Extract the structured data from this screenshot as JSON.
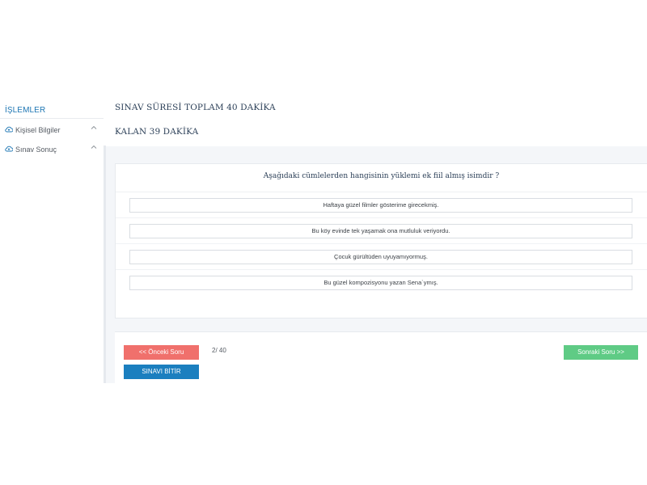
{
  "sidebar": {
    "heading": "İŞLEMLER",
    "items": [
      {
        "label": "Kişisel Bilgiler",
        "icon": "cloud-icon"
      },
      {
        "label": "Sınav Sonuç",
        "icon": "cloud-icon"
      }
    ]
  },
  "exam": {
    "total_time_label": "SINAV SÜRESİ TOPLAM 40 DAKİKA",
    "remaining_label": "KALAN 39 DAKİKA"
  },
  "question": {
    "text": "Aşağıdaki cümlelerden hangisinin yüklemi ek fiil almış isimdir ?",
    "options": [
      "Haftaya güzel filmler gösterime girecekmiş.",
      "Bu köy evinde tek yaşamak ona mutluluk veriyordu.",
      "Çocuk gürültüden uyuyamıyormuş.",
      "Bu güzel kompozisyonu yazan Sena`ymış."
    ]
  },
  "navigation": {
    "prev_label": "<< Önceki Soru",
    "next_label": "Sonraki Soru >>",
    "finish_label": "SINAVI BİTİR",
    "counter": "2/ 40"
  },
  "colors": {
    "accent": "#1f77b4",
    "prev_button": "#f0706c",
    "next_button": "#5fcb85",
    "finish_button": "#1b7fbf"
  }
}
